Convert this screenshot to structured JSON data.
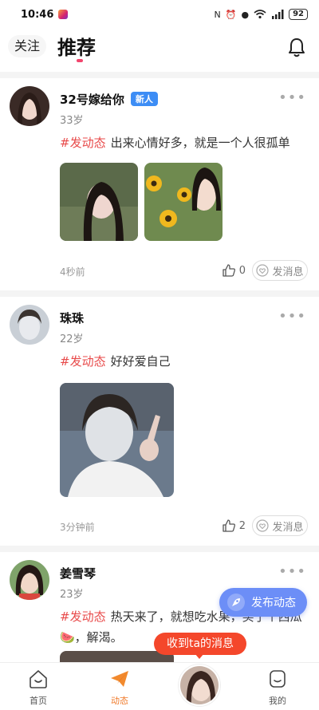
{
  "status_bar": {
    "time": "10:46",
    "battery": "92"
  },
  "header": {
    "tab_follow": "关注",
    "tab_recommend": "推荐"
  },
  "posts": [
    {
      "name": "32号嫁给你",
      "badge": "新人",
      "age": "33岁",
      "hashtag": "#发动态",
      "text": "出来心情好多，就是一个人很孤单",
      "time": "4秒前",
      "likes": "0",
      "message_label": "发消息"
    },
    {
      "name": "珠珠",
      "badge": "",
      "age": "22岁",
      "hashtag": "#发动态",
      "text": "好好爱自己",
      "time": "3分钟前",
      "likes": "2",
      "message_label": "发消息"
    },
    {
      "name": "姜雪琴",
      "badge": "",
      "age": "23岁",
      "hashtag": "#发动态",
      "text": "热天来了，就想吃水果，买了个西瓜🍉，解渴。"
    }
  ],
  "floating": {
    "publish_label": "发布动态",
    "message_tip": "收到ta的消息"
  },
  "bottom_nav": {
    "home": "首页",
    "moments": "动态",
    "mine": "我的"
  },
  "colors": {
    "accent_red": "#f2456d",
    "hashtag": "#e84a4a",
    "publish_blue": "#6c8ef7",
    "tip_red": "#f4472b",
    "badge_blue": "#3d8df5"
  }
}
